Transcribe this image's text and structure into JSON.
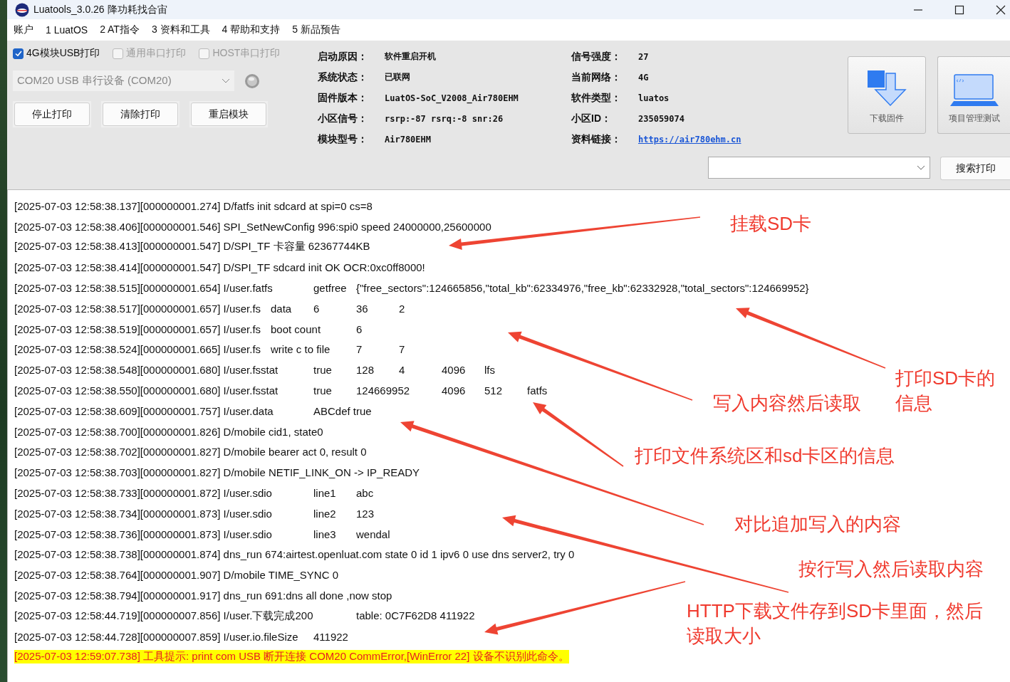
{
  "window": {
    "title": "Luatools_3.0.26 降功耗找合宙"
  },
  "menu": [
    "账户",
    "1 LuatOS",
    "2 AT指令",
    "3 资料和工具",
    "4 帮助和支持",
    "5 新品预告"
  ],
  "print_options": [
    {
      "label": "4G模块USB打印",
      "checked": true,
      "disabled": false
    },
    {
      "label": "通用串口打印",
      "checked": false,
      "disabled": true
    },
    {
      "label": "HOST串口打印",
      "checked": false,
      "disabled": true
    }
  ],
  "port_select": {
    "value": "COM20 USB 串行设备 (COM20)",
    "disabled": true
  },
  "buttons": [
    "停止打印",
    "清除打印",
    "重启模块"
  ],
  "device_info": [
    {
      "label": "启动原因：",
      "value": "软件重启开机",
      "kind": "text"
    },
    {
      "label": "信号强度：",
      "value": "27",
      "kind": "text"
    },
    {
      "label": "系统状态：",
      "value": "已联网",
      "kind": "text"
    },
    {
      "label": "当前网络：",
      "value": "4G",
      "kind": "text"
    },
    {
      "label": "固件版本：",
      "value": "LuatOS-SoC_V2008_Air780EHM",
      "kind": "text"
    },
    {
      "label": "软件类型：",
      "value": "luatos",
      "kind": "text"
    },
    {
      "label": "小区信号：",
      "value": "rsrp:-87 rsrq:-8 snr:26",
      "kind": "text"
    },
    {
      "label": "小区ID：",
      "value": "235059074",
      "kind": "text"
    },
    {
      "label": "模块型号：",
      "value": "Air780EHM",
      "kind": "text"
    },
    {
      "label": "资料链接：",
      "value": "https://air780ehm.cn",
      "kind": "link"
    }
  ],
  "tool_buttons": [
    {
      "label": "下载固件",
      "kind": "download"
    },
    {
      "label": "项目管理测试",
      "kind": "laptop"
    }
  ],
  "search_button": "搜索打印",
  "log": [
    {
      "kind": "normal",
      "text": "[2025-07-03 12:58:38.137][000000001.274] D/fatfs init sdcard at spi=0 cs=8"
    },
    {
      "kind": "normal",
      "text": "[2025-07-03 12:58:38.406][000000001.546] SPI_SetNewConfig 996:spi0 speed 24000000,25600000"
    },
    {
      "kind": "normal",
      "text": "[2025-07-03 12:58:38.413][000000001.547] D/SPI_TF 卡容量 62367744KB"
    },
    {
      "kind": "normal",
      "text": "[2025-07-03 12:58:38.414][000000001.547] D/SPI_TF sdcard init OK OCR:0xc0ff8000!"
    },
    {
      "kind": "normal",
      "text": "[2025-07-03 12:58:38.515][000000001.654] I/user.fatfs\tgetfree\t{\"free_sectors\":124665856,\"total_kb\":62334976,\"free_kb\":62332928,\"total_sectors\":124669952}"
    },
    {
      "kind": "normal",
      "text": "[2025-07-03 12:58:38.517][000000001.657] I/user.fs\tdata\t6\t36\t2"
    },
    {
      "kind": "normal",
      "text": "[2025-07-03 12:58:38.519][000000001.657] I/user.fs\tboot count\t6"
    },
    {
      "kind": "normal",
      "text": "[2025-07-03 12:58:38.524][000000001.665] I/user.fs\twrite c to file\t7\t7"
    },
    {
      "kind": "normal",
      "text": "[2025-07-03 12:58:38.548][000000001.680] I/user.fsstat\ttrue\t128\t4\t4096\tlfs"
    },
    {
      "kind": "normal",
      "text": "[2025-07-03 12:58:38.550][000000001.680] I/user.fsstat\ttrue\t124669952\t4096\t512\tfatfs"
    },
    {
      "kind": "normal",
      "text": "[2025-07-03 12:58:38.609][000000001.757] I/user.data\tABCdef true"
    },
    {
      "kind": "normal",
      "text": "[2025-07-03 12:58:38.700][000000001.826] D/mobile cid1, state0"
    },
    {
      "kind": "normal",
      "text": "[2025-07-03 12:58:38.702][000000001.827] D/mobile bearer act 0, result 0"
    },
    {
      "kind": "normal",
      "text": "[2025-07-03 12:58:38.703][000000001.827] D/mobile NETIF_LINK_ON -> IP_READY"
    },
    {
      "kind": "normal",
      "text": "[2025-07-03 12:58:38.733][000000001.872] I/user.sdio\tline1\tabc"
    },
    {
      "kind": "normal",
      "text": "[2025-07-03 12:58:38.734][000000001.873] I/user.sdio\tline2\t123"
    },
    {
      "kind": "normal",
      "text": "[2025-07-03 12:58:38.736][000000001.873] I/user.sdio\tline3\twendal"
    },
    {
      "kind": "normal",
      "text": "[2025-07-03 12:58:38.738][000000001.874] dns_run 674:airtest.openluat.com state 0 id 1 ipv6 0 use dns server2, try 0"
    },
    {
      "kind": "normal",
      "text": "[2025-07-03 12:58:38.764][000000001.907] D/mobile TIME_SYNC 0"
    },
    {
      "kind": "normal",
      "text": "[2025-07-03 12:58:38.794][000000001.917] dns_run 691:dns all done ,now stop"
    },
    {
      "kind": "normal",
      "text": "[2025-07-03 12:58:44.719][000000007.856] I/user.下载完成200\ttable: 0C7F62D8 411922"
    },
    {
      "kind": "normal",
      "text": "[2025-07-03 12:58:44.728][000000007.859] I/user.io.fileSize\t411922"
    },
    {
      "kind": "alert",
      "text": "[2025-07-03 12:59:07.738] 工具提示: print com USB 断开连接 COM20 CommError,[WinError 22] 设备不识别此命令。"
    }
  ],
  "annotations": [
    {
      "text": "挂载SD卡"
    },
    {
      "text": "写入内容然后读取"
    },
    {
      "text": "打印SD卡的信息"
    },
    {
      "text": "打印文件系统区和sd卡区的信息"
    },
    {
      "text": "对比追加写入的内容"
    },
    {
      "text": "按行写入然后读取内容"
    },
    {
      "text": "HTTP下载文件存到SD卡里面，然后读取大小"
    }
  ]
}
